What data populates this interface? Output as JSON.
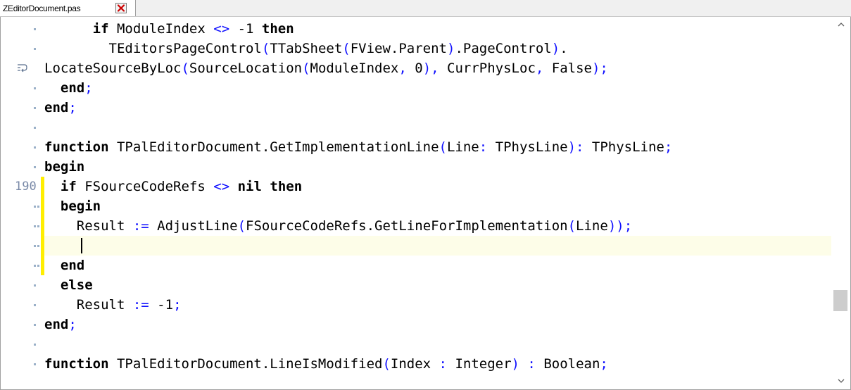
{
  "tab": {
    "title": "ZEditorDocument.pas",
    "close_icon": "close-icon",
    "close_color": "#cc0000"
  },
  "gutter": {
    "line_number": "190"
  },
  "lines": [
    [
      {
        "t": "      ",
        "c": ""
      },
      {
        "t": "if",
        "c": "kw"
      },
      {
        "t": " ModuleIndex ",
        "c": ""
      },
      {
        "t": "<>",
        "c": "sym"
      },
      {
        "t": " -1 ",
        "c": ""
      },
      {
        "t": "then",
        "c": "kw"
      }
    ],
    [
      {
        "t": "        TEditorsPageControl",
        "c": ""
      },
      {
        "t": "(",
        "c": "sym"
      },
      {
        "t": "TTabSheet",
        "c": ""
      },
      {
        "t": "(",
        "c": "sym"
      },
      {
        "t": "FView.Parent",
        "c": ""
      },
      {
        "t": ")",
        "c": "sym"
      },
      {
        "t": ".PageControl",
        "c": ""
      },
      {
        "t": ")",
        "c": "sym"
      },
      {
        "t": ".",
        "c": ""
      }
    ],
    [
      {
        "t": "LocateSourceByLoc",
        "c": ""
      },
      {
        "t": "(",
        "c": "sym"
      },
      {
        "t": "SourceLocation",
        "c": ""
      },
      {
        "t": "(",
        "c": "sym"
      },
      {
        "t": "ModuleIndex",
        "c": ""
      },
      {
        "t": ",",
        "c": "sym"
      },
      {
        "t": " 0",
        "c": ""
      },
      {
        "t": "),",
        "c": "sym"
      },
      {
        "t": " CurrPhysLoc",
        "c": ""
      },
      {
        "t": ",",
        "c": "sym"
      },
      {
        "t": " False",
        "c": ""
      },
      {
        "t": ");",
        "c": "sym"
      }
    ],
    [
      {
        "t": "  ",
        "c": ""
      },
      {
        "t": "end",
        "c": "kw"
      },
      {
        "t": ";",
        "c": "sym"
      }
    ],
    [
      {
        "t": "end",
        "c": "kw"
      },
      {
        "t": ";",
        "c": "sym"
      }
    ],
    [],
    [
      {
        "t": "function",
        "c": "kw"
      },
      {
        "t": " TPalEditorDocument.GetImplementationLine",
        "c": ""
      },
      {
        "t": "(",
        "c": "sym"
      },
      {
        "t": "Line",
        "c": ""
      },
      {
        "t": ":",
        "c": "sym"
      },
      {
        "t": " TPhysLine",
        "c": ""
      },
      {
        "t": "):",
        "c": "sym"
      },
      {
        "t": " TPhysLine",
        "c": ""
      },
      {
        "t": ";",
        "c": "sym"
      }
    ],
    [
      {
        "t": "begin",
        "c": "kw"
      }
    ],
    [
      {
        "t": "  ",
        "c": ""
      },
      {
        "t": "if",
        "c": "kw"
      },
      {
        "t": " FSourceCodeRefs ",
        "c": ""
      },
      {
        "t": "<>",
        "c": "sym"
      },
      {
        "t": " ",
        "c": ""
      },
      {
        "t": "nil",
        "c": "kw"
      },
      {
        "t": " ",
        "c": ""
      },
      {
        "t": "then",
        "c": "kw"
      }
    ],
    [
      {
        "t": "  ",
        "c": ""
      },
      {
        "t": "begin",
        "c": "kw"
      }
    ],
    [
      {
        "t": "    Result ",
        "c": ""
      },
      {
        "t": ":=",
        "c": "sym"
      },
      {
        "t": " AdjustLine",
        "c": ""
      },
      {
        "t": "(",
        "c": "sym"
      },
      {
        "t": "FSourceCodeRefs.GetLineForImplementation",
        "c": ""
      },
      {
        "t": "(",
        "c": "sym"
      },
      {
        "t": "Line",
        "c": ""
      },
      {
        "t": "));",
        "c": "sym"
      }
    ],
    [],
    [
      {
        "t": "  ",
        "c": ""
      },
      {
        "t": "end",
        "c": "kw"
      }
    ],
    [
      {
        "t": "  ",
        "c": ""
      },
      {
        "t": "else",
        "c": "kw"
      }
    ],
    [
      {
        "t": "    Result ",
        "c": ""
      },
      {
        "t": ":=",
        "c": "sym"
      },
      {
        "t": " -1",
        "c": ""
      },
      {
        "t": ";",
        "c": "sym"
      }
    ],
    [
      {
        "t": "end",
        "c": "kw"
      },
      {
        "t": ";",
        "c": "sym"
      }
    ],
    [],
    [
      {
        "t": "function",
        "c": "kw"
      },
      {
        "t": " TPalEditorDocument.LineIsModified",
        "c": ""
      },
      {
        "t": "(",
        "c": "sym"
      },
      {
        "t": "Index ",
        "c": ""
      },
      {
        "t": ":",
        "c": "sym"
      },
      {
        "t": " Integer",
        "c": ""
      },
      {
        "t": ")",
        "c": "sym"
      },
      {
        "t": " ",
        "c": ""
      },
      {
        "t": ":",
        "c": "sym"
      },
      {
        "t": " Boolean",
        "c": ""
      },
      {
        "t": ";",
        "c": "sym"
      }
    ]
  ],
  "gutter_marks": [
    "dot-a",
    "dot-a",
    "wrap",
    "dot-a",
    "dot-a",
    "dot-a",
    "dot-a",
    "dot-a",
    "number",
    "dots-bar",
    "dots-bar",
    "dots-bar",
    "dots-bar",
    "dot-a",
    "dot-a",
    "dot-a",
    "dot-a",
    "dot-a"
  ],
  "current_line_index": 11,
  "colors": {
    "symbol": "#1010ff",
    "modified_bar": "#ffee00",
    "current_line": "#fdfde8",
    "line_number": "#7a8aa8"
  },
  "scrollbar": {
    "up_icon": "chevron-up-icon",
    "down_icon": "chevron-down-icon"
  }
}
